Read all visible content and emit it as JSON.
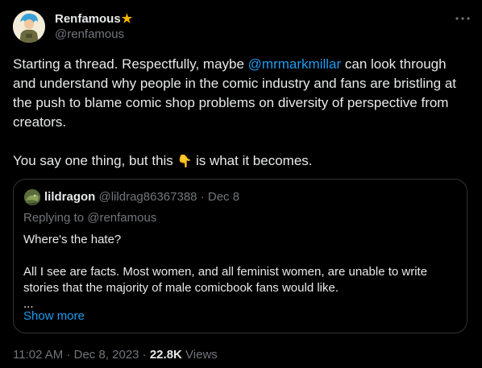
{
  "author": {
    "display_name": "Renfamous",
    "badge_icon": "star-icon",
    "handle": "@renfamous",
    "more_icon": "more-icon"
  },
  "tweet": {
    "text_before_mention": "Starting a thread. Respectfully, maybe ",
    "mention": "@mrmarkmillar",
    "text_after_mention": " can look through and understand why people in the comic industry and fans are bristling at the push to blame comic shop problems on diversity of perspective from creators.",
    "line2_before": "You say one thing, but this ",
    "emoji": "👇",
    "line2_after": " is what it becomes."
  },
  "quote": {
    "display_name": "lildragon",
    "handle": "@lildrag86367388",
    "dot": "·",
    "date": "Dec 8",
    "replying_label": "Replying to ",
    "replying_to": "@renfamous",
    "line1": "Where's the hate?",
    "line2": "All I see are facts. Most women, and all feminist women, are unable to write stories that the majority of male comicbook fans would like.",
    "ellipsis": "...",
    "show_more": "Show more"
  },
  "meta": {
    "time": "11:02 AM",
    "dot1": "·",
    "date": "Dec 8, 2023",
    "dot2": "·",
    "views_count": "22.8K",
    "views_label": "Views"
  },
  "colors": {
    "background": "#000000",
    "text": "#e7e9ea",
    "secondary": "#71767b",
    "link": "#1d9bf0",
    "border": "#2f3336",
    "star": "#f5b400"
  }
}
